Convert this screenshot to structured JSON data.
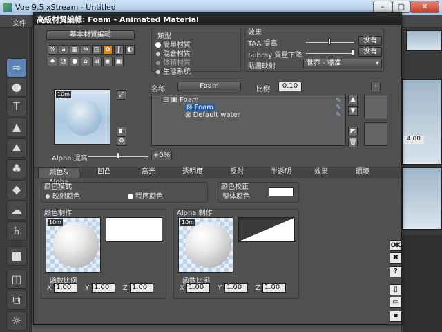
{
  "app": {
    "title": "Vue 9.5 xStream - Untitled",
    "menu_file": "文件",
    "win_min": "–",
    "win_max": "▢",
    "win_close": "✕"
  },
  "dialog": {
    "title": "高級材質編輯: Foam - Animated Material",
    "basic_editor_button": "基本材質編輯",
    "type_label": "類型",
    "types": [
      "簡單材質",
      "混合材質",
      "体積材質",
      "生態系統"
    ],
    "effects_label": "效果",
    "taa_label": "TAA 提高",
    "taa_button": "没有",
    "subray_label": "Subray 質量下降",
    "subray_button": "没有",
    "mapping_label": "貼圖映射",
    "mapping_value": "世界 - 標准",
    "name_label": "名称",
    "name_value": "Foam",
    "scale_label": "比例",
    "scale_value": "0.10",
    "tree": {
      "root": "Foam",
      "child1": "Foam",
      "child2": "Default water"
    },
    "preview_badge": "10m",
    "alpha_boost_label": "Alpha 提高",
    "alpha_boost_value": "+0%",
    "tabs": [
      "颜色& Alpha",
      "凹凸",
      "高光",
      "透明度",
      "反射",
      "半透明",
      "效果",
      "環境"
    ],
    "color_mode_label": "颜色模式",
    "color_modes": [
      "映射颜色",
      "程序颜色"
    ],
    "color_correction_label": "颜色校正",
    "overall_color_label": "整体颜色",
    "color_production_label": "颜色制作",
    "alpha_production_label": "Alpha 制作",
    "func_scale_label": "函数比例",
    "axis_x": "X",
    "axis_y": "Y",
    "axis_z": "Z",
    "color_scale": {
      "x": "1.00",
      "y": "1.00",
      "z": "1.00"
    },
    "alpha_scale": {
      "x": "1.00",
      "y": "1.00",
      "z": "1.00"
    },
    "ok": "OK",
    "cancel": "✖",
    "help": "?"
  },
  "side": {
    "viewport_value": "4.00"
  }
}
